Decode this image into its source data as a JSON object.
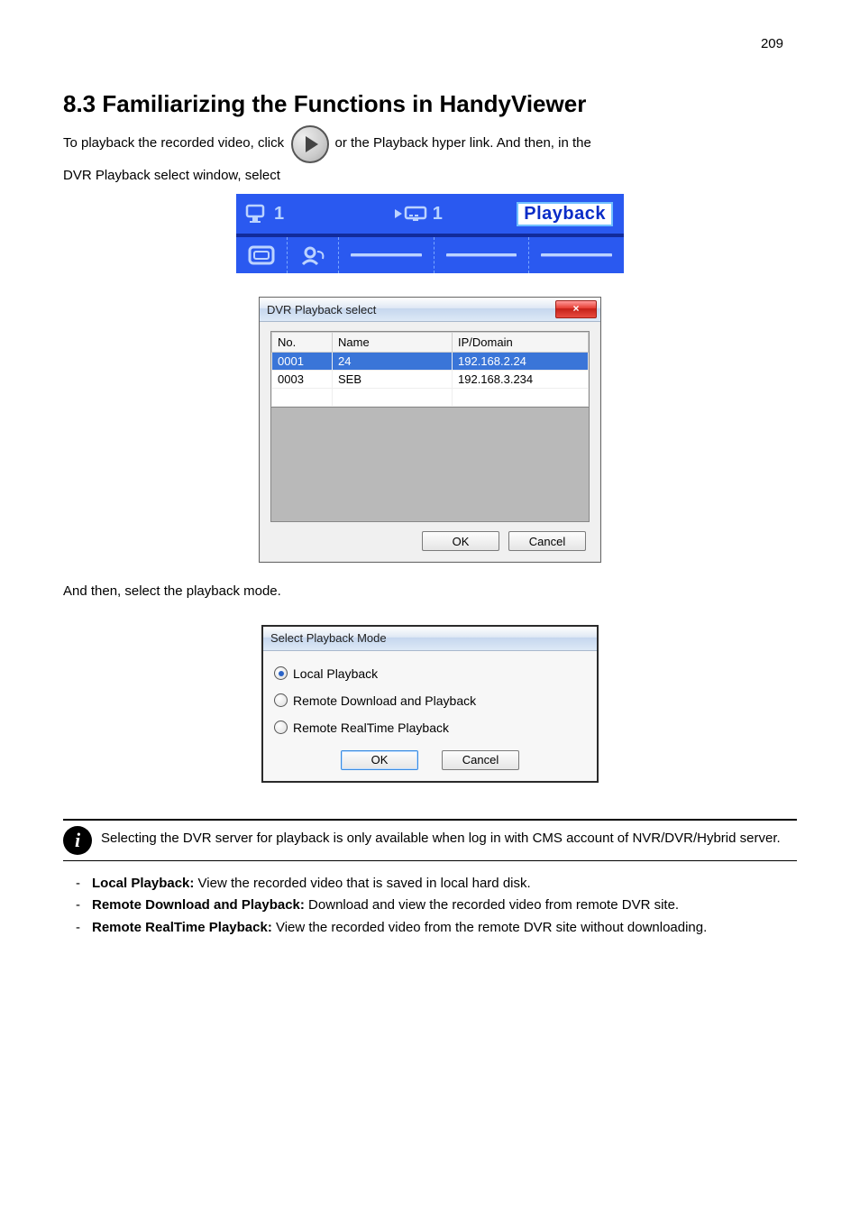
{
  "page_number": "209",
  "section_title": "8.3 Familiarizing the Functions in HandyViewer",
  "intro_text_1": "To playback the recorded video, click",
  "intro_text_2": "or the Playback hyper link. And then, in the",
  "intro_text_3": "DVR Playback select window, select",
  "strip": {
    "seg1": "1",
    "seg2": "1",
    "playback_label": "Playback"
  },
  "dvr_dialog": {
    "title": "DVR Playback select",
    "close": "×",
    "col_no": "No.",
    "col_name": "Name",
    "col_ip": "IP/Domain",
    "rows": [
      {
        "no": "0001",
        "name": "24",
        "ip": "192.168.2.24",
        "selected": true
      },
      {
        "no": "0003",
        "name": "SEB",
        "ip": "192.168.3.234",
        "selected": false
      }
    ],
    "ok": "OK",
    "cancel": "Cancel"
  },
  "between_text": "And then, select the playback mode.",
  "mode_dialog": {
    "title": "Select Playback Mode",
    "options": [
      {
        "label": "Local Playback",
        "checked": true
      },
      {
        "label": "Remote Download and Playback",
        "checked": false
      },
      {
        "label": "Remote RealTime Playback",
        "checked": false
      }
    ],
    "ok": "OK",
    "cancel": "Cancel"
  },
  "note_text": "Selecting the DVR server for playback is only available when log in with CMS account of NVR/DVR/Hybrid server.",
  "bullets": [
    {
      "bold": "Local Playback:",
      "rest": " View the recorded video that is saved in local hard disk."
    },
    {
      "bold": "Remote Download and Playback:",
      "rest": " Download and view the recorded video from remote DVR site."
    },
    {
      "bold": "Remote RealTime Playback:",
      "rest": " View the recorded video from the remote DVR site without downloading."
    }
  ]
}
